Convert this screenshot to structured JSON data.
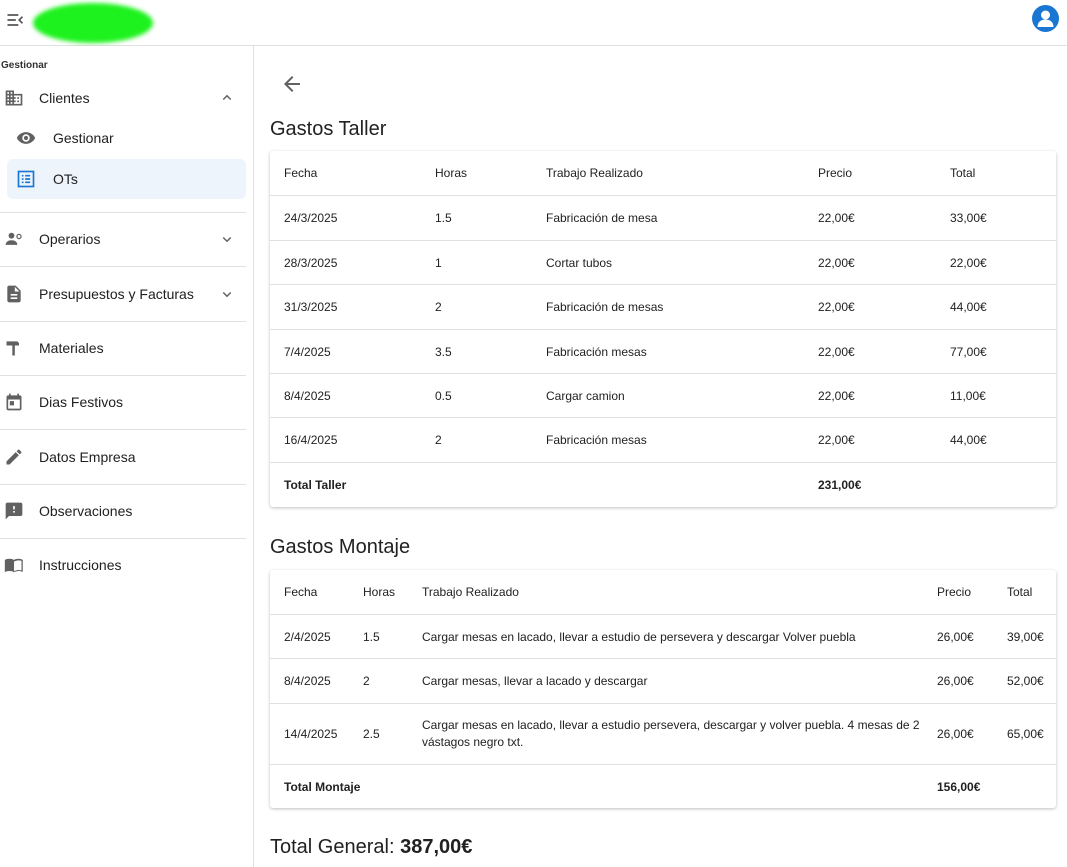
{
  "sidebar": {
    "section_label": "Gestionar",
    "clientes": {
      "label": "Clientes",
      "icon": "building-icon"
    },
    "sub_items": [
      {
        "label": "Gestionar",
        "icon": "eye-icon"
      },
      {
        "label": "OTs",
        "icon": "list-icon"
      }
    ],
    "items": [
      {
        "label": "Operarios",
        "icon": "people-icon"
      },
      {
        "label": "Presupuestos y Facturas",
        "icon": "document-icon"
      },
      {
        "label": "Materiales",
        "icon": "hammer-icon"
      },
      {
        "label": "Dias Festivos",
        "icon": "calendar-icon"
      },
      {
        "label": "Datos Empresa",
        "icon": "pencil-icon"
      },
      {
        "label": "Observaciones",
        "icon": "feedback-icon"
      },
      {
        "label": "Instrucciones",
        "icon": "book-icon"
      }
    ]
  },
  "taller": {
    "title": "Gastos Taller",
    "headers": [
      "Fecha",
      "Horas",
      "Trabajo Realizado",
      "Precio",
      "Total"
    ],
    "rows": [
      [
        "24/3/2025",
        "1.5",
        "Fabricación de mesa",
        "22,00€",
        "33,00€"
      ],
      [
        "28/3/2025",
        "1",
        "Cortar tubos",
        "22,00€",
        "22,00€"
      ],
      [
        "31/3/2025",
        "2",
        "Fabricación de mesas",
        "22,00€",
        "44,00€"
      ],
      [
        "7/4/2025",
        "3.5",
        "Fabricación mesas",
        "22,00€",
        "77,00€"
      ],
      [
        "8/4/2025",
        "0.5",
        "Cargar camion",
        "22,00€",
        "11,00€"
      ],
      [
        "16/4/2025",
        "2",
        "Fabricación mesas",
        "22,00€",
        "44,00€"
      ]
    ],
    "total_label": "Total Taller",
    "total_value": "231,00€"
  },
  "montaje": {
    "title": "Gastos Montaje",
    "headers": [
      "Fecha",
      "Horas",
      "Trabajo Realizado",
      "Precio",
      "Total"
    ],
    "rows": [
      [
        "2/4/2025",
        "1.5",
        "Cargar mesas en lacado, llevar a estudio de persevera y descargar Volver puebla",
        "26,00€",
        "39,00€"
      ],
      [
        "8/4/2025",
        "2",
        "Cargar mesas, llevar a lacado y descargar",
        "26,00€",
        "52,00€"
      ],
      [
        "14/4/2025",
        "2.5",
        "Cargar mesas en lacado, llevar a estudio persevera, descargar y volver puebla. 4 mesas de 2 vástagos negro txt.",
        "26,00€",
        "65,00€"
      ]
    ],
    "total_label": "Total Montaje",
    "total_value": "156,00€"
  },
  "grand_total": {
    "label": "Total General:",
    "value": "387,00€"
  }
}
